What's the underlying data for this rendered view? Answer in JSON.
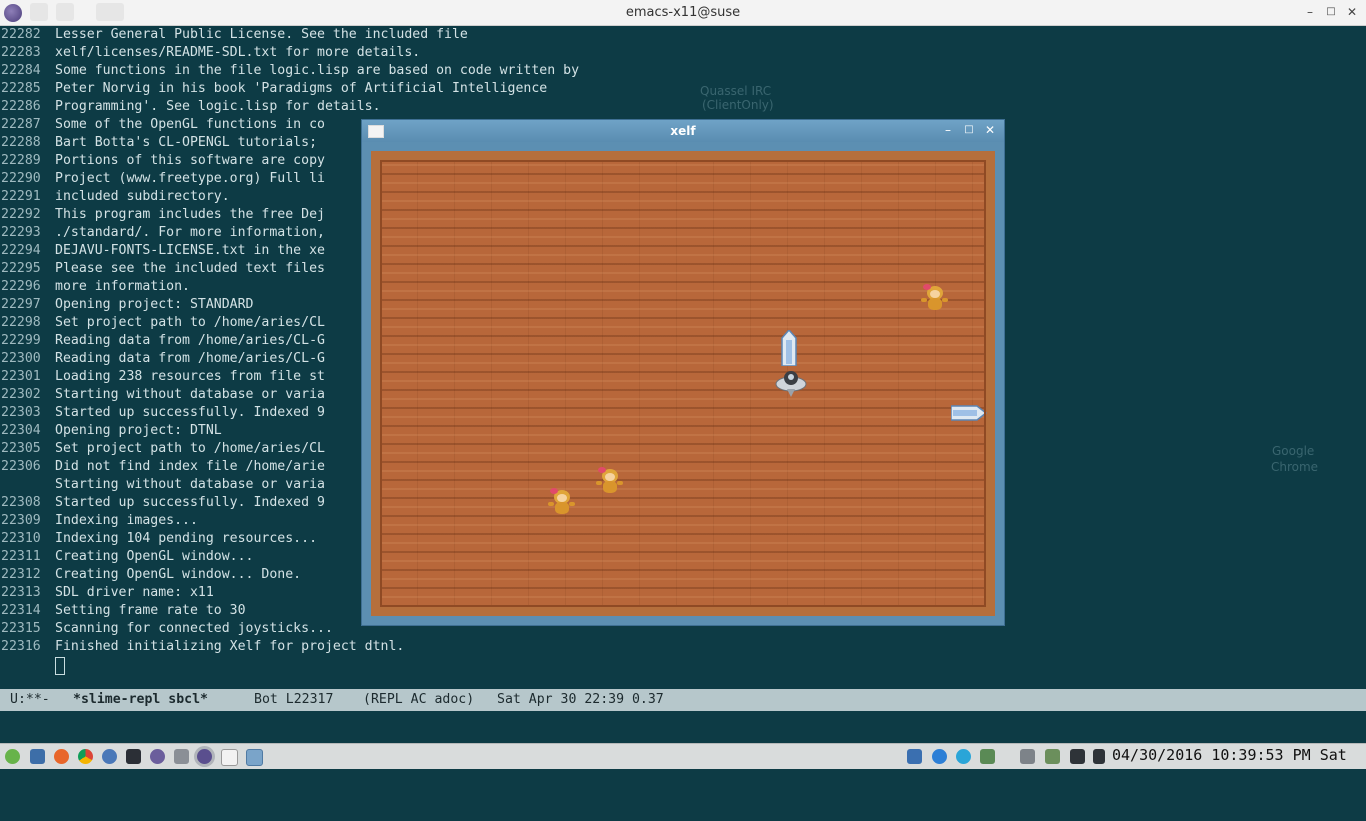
{
  "titlebar": {
    "title": "emacs-x11@suse"
  },
  "buffer_lines": [
    {
      "n": "22282",
      "text": "Lesser General Public License. See the included file"
    },
    {
      "n": "22283",
      "text": "xelf/licenses/README-SDL.txt for more details."
    },
    {
      "n": "22284",
      "text": "Some functions in the file logic.lisp are based on code written by"
    },
    {
      "n": "22285",
      "text": "Peter Norvig in his book 'Paradigms of Artificial Intelligence"
    },
    {
      "n": "22286",
      "text": "Programming'. See logic.lisp for details."
    },
    {
      "n": "22287",
      "text": "Some of the OpenGL functions in co"
    },
    {
      "n": "22288",
      "text": "Bart Botta's CL-OPENGL tutorials;"
    },
    {
      "n": "22289",
      "text": "Portions of this software are copy"
    },
    {
      "n": "22290",
      "text": "Project (www.freetype.org) Full li"
    },
    {
      "n": "22291",
      "text": "included subdirectory."
    },
    {
      "n": "22292",
      "text": "This program includes the free Dej"
    },
    {
      "n": "22293",
      "text": "./standard/. For more information,"
    },
    {
      "n": "22294",
      "text": "DEJAVU-FONTS-LICENSE.txt in the xe"
    },
    {
      "n": "22295",
      "text": "Please see the included text files"
    },
    {
      "n": "22296",
      "text": "more information."
    },
    {
      "n": "22297",
      "text": "Opening project: STANDARD"
    },
    {
      "n": "22298",
      "text": "Set project path to /home/aries/CL"
    },
    {
      "n": "22299",
      "text": "Reading data from /home/aries/CL-G"
    },
    {
      "n": "22300",
      "text": "Reading data from /home/aries/CL-G"
    },
    {
      "n": "22301",
      "text": "Loading 238 resources from file st"
    },
    {
      "n": "22302",
      "text": "Starting without database or varia"
    },
    {
      "n": "22303",
      "text": "Started up successfully. Indexed 9"
    },
    {
      "n": "22304",
      "text": "Opening project: DTNL"
    },
    {
      "n": "22305",
      "text": "Set project path to /home/aries/CL"
    },
    {
      "n": "22306",
      "text": "Did not find index file /home/arie"
    },
    {
      "n": "",
      "text": "Starting without database or varia"
    },
    {
      "n": "22308",
      "text": "Started up successfully. Indexed 9"
    },
    {
      "n": "22309",
      "text": "Indexing images..."
    },
    {
      "n": "22310",
      "text": "Indexing 104 pending resources..."
    },
    {
      "n": "22311",
      "text": "Creating OpenGL window..."
    },
    {
      "n": "22312",
      "text": "Creating OpenGL window... Done."
    },
    {
      "n": "22313",
      "text": "SDL driver name: x11"
    },
    {
      "n": "22314",
      "text": "Setting frame rate to 30"
    },
    {
      "n": "22315",
      "text": "Scanning for connected joysticks..."
    },
    {
      "n": "22316",
      "text": "Finished initializing Xelf for project dtnl."
    }
  ],
  "modeline": {
    "status": "U:**-",
    "buffer": "*slime-repl sbcl*",
    "position": "Bot L22317",
    "modes": "(REPL AC adoc)",
    "datetime": "Sat Apr 30 22:39 0.37"
  },
  "desktop_ghosts": [
    "Quassel IRC",
    "(ClientOnly)",
    "Google",
    "Chrome"
  ],
  "xelf_window": {
    "title": "xelf"
  },
  "taskbar": {
    "clock": "04/30/2016 10:39:53 PM Sat"
  }
}
